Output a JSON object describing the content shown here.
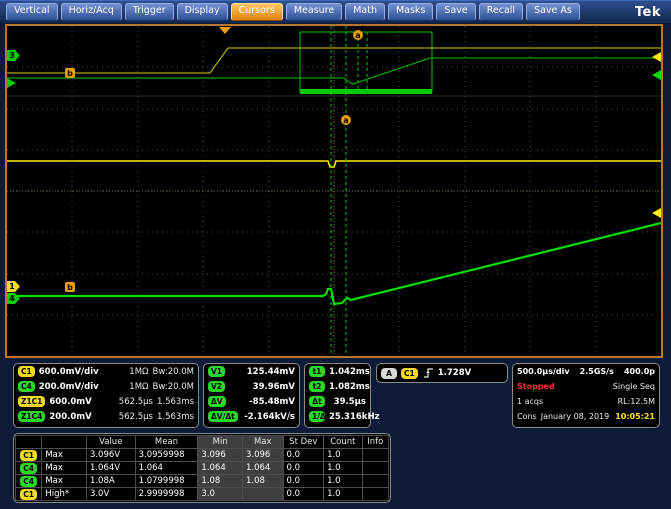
{
  "colors": {
    "c1_trace": "#ffee00",
    "c4_trace": "#00e000",
    "active_menu": "#e8941c",
    "status_stopped": "#ff3030",
    "clock": "#ffe000"
  },
  "toolbar": {
    "buttons": [
      "Vertical",
      "Horiz/Acq",
      "Trigger",
      "Display",
      "Cursors",
      "Measure",
      "Math",
      "Masks",
      "Save",
      "Recall",
      "Save As"
    ],
    "active_button": "Cursors",
    "logo": "Tek"
  },
  "waveform": {
    "markers": {
      "cursor_a": "a",
      "cursor_b": "b",
      "ch3": "3",
      "ch1": "1",
      "ch4": "4"
    },
    "traces": {
      "z1c1": "0,47 203,47 221,22 654,22",
      "z1c4": "0,52 337,52 342,56 346,58 352,56 423,32 654,32",
      "c1": "0,135 321,135 323,141 327,141 329,135 654,135",
      "c4": "0,270 316,270 319,268 321,263 324,263 327,278 335,277 340,272 344,274 654,197"
    }
  },
  "readouts": {
    "channels": [
      {
        "badge": "C1",
        "color": "yellow",
        "scale": "600.0mV/div",
        "imp": "1MΩ",
        "bw": "Bw:20.0M"
      },
      {
        "badge": "C4",
        "color": "green",
        "scale": "200.0mV/div",
        "imp": "1MΩ",
        "bw": "Bw:20.0M"
      },
      {
        "badge": "Z1C1",
        "color": "yellow",
        "scale": "600.0mV",
        "imp": "562.5µs",
        "bw": "1.563ms"
      },
      {
        "badge": "Z1C4",
        "color": "green",
        "scale": "200.0mV",
        "imp": "562.5µs",
        "bw": "1.563ms"
      }
    ],
    "v_cursors": [
      {
        "label": "V1",
        "value": "125.44mV"
      },
      {
        "label": "V2",
        "value": "39.96mV"
      },
      {
        "label": "ΔV",
        "value": "-85.48mV"
      },
      {
        "label": "ΔV/Δt",
        "value": "-2.164kV/s"
      }
    ],
    "t_cursors": [
      {
        "label": "t1",
        "value": "1.042ms"
      },
      {
        "label": "t2",
        "value": "1.082ms"
      },
      {
        "label": "Δt",
        "value": "39.5µs"
      },
      {
        "label": "1/Δt",
        "value": "25.316kHz"
      }
    ],
    "trigger": {
      "bus": "A",
      "source": "C1",
      "level": "1.728V"
    },
    "acquisition": {
      "timebase": "500.0µs/div",
      "sample_rate": "2.5GS/s",
      "resolution": "400.0p",
      "status": "Stopped",
      "mode": "Single Seq",
      "acqs": "1 acqs",
      "record_length": "RL:12.5M",
      "label": "Cons",
      "date": "January 08, 2019",
      "time": "10:05:21"
    }
  },
  "measurements": {
    "headers": [
      "Value",
      "Mean",
      "Min",
      "Max",
      "St Dev",
      "Count",
      "Info"
    ],
    "rows": [
      {
        "source": "C1",
        "color": "yellow",
        "name": "Max",
        "value": "3.096V",
        "mean": "3.0959998",
        "min": "3.096",
        "max": "3.096",
        "stdev": "0.0",
        "count": "1.0",
        "info": ""
      },
      {
        "source": "C4",
        "color": "green",
        "name": "Max",
        "value": "1.064V",
        "mean": "1.064",
        "min": "1.064",
        "max": "1.064",
        "stdev": "0.0",
        "count": "1.0",
        "info": ""
      },
      {
        "source": "C4",
        "color": "green",
        "name": "Max",
        "value": "1.08A",
        "mean": "1.0799998",
        "min": "1.08",
        "max": "1.08",
        "stdev": "0.0",
        "count": "1.0",
        "info": ""
      },
      {
        "source": "C1",
        "color": "yellow",
        "name": "High*",
        "value": "3.0V",
        "mean": "2.9999998",
        "min": "3.0",
        "max": "",
        "stdev": "0.0",
        "count": "1.0",
        "info": ""
      }
    ]
  }
}
